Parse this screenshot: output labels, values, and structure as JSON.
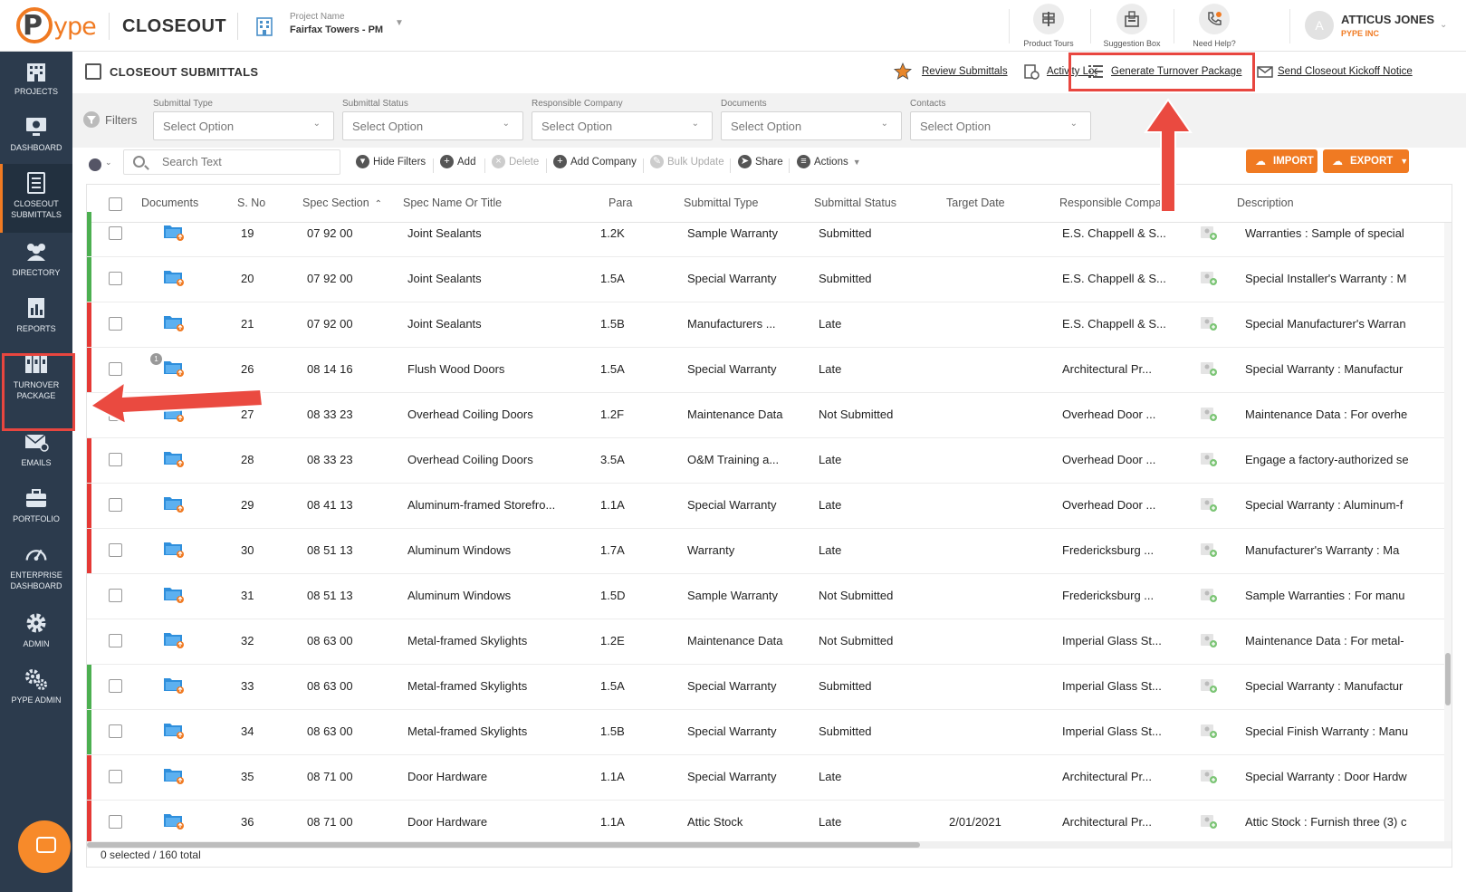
{
  "topbar": {
    "brand": "CLOSEOUT",
    "project_label": "Project Name",
    "project_name": "Fairfax Towers - PM",
    "actions": [
      {
        "label": "Product Tours"
      },
      {
        "label": "Suggestion Box"
      },
      {
        "label": "Need Help?"
      }
    ],
    "user": {
      "initial": "A",
      "name": "ATTICUS JONES",
      "org": "PYPE INC"
    }
  },
  "sidebar": {
    "items": [
      {
        "label": "PROJECTS",
        "icon": "building-icon"
      },
      {
        "label": "DASHBOARD",
        "icon": "monitor-icon"
      },
      {
        "label": "CLOSEOUT SUBMITTALS",
        "icon": "document-list-icon",
        "active": true
      },
      {
        "label": "DIRECTORY",
        "icon": "people-icon"
      },
      {
        "label": "REPORTS",
        "icon": "report-icon"
      },
      {
        "label": "TURNOVER PACKAGE",
        "icon": "binders-icon"
      },
      {
        "label": "EMAILS",
        "icon": "email-icon"
      },
      {
        "label": "PORTFOLIO",
        "icon": "briefcase-icon"
      },
      {
        "label": "ENTERPRISE DASHBOARD",
        "icon": "gauge-icon"
      },
      {
        "label": "ADMIN",
        "icon": "gear-icon"
      },
      {
        "label": "PYPE ADMIN",
        "icon": "gears-icon"
      }
    ]
  },
  "header": {
    "title": "CLOSEOUT SUBMITTALS",
    "links": {
      "review": "Review Submittals",
      "activity": "Activity Log",
      "generate": "Generate Turnover Package",
      "kickoff": "Send Closeout Kickoff Notice"
    }
  },
  "filters": {
    "label": "Filters",
    "fields": [
      {
        "caption": "Submittal Type",
        "value": "Select Option"
      },
      {
        "caption": "Submittal Status",
        "value": "Select Option"
      },
      {
        "caption": "Responsible Company",
        "value": "Select Option"
      },
      {
        "caption": "Documents",
        "value": "Select Option"
      },
      {
        "caption": "Contacts",
        "value": "Select Option"
      }
    ]
  },
  "toolbar": {
    "search_placeholder": "Search Text",
    "hide_filters": "Hide Filters",
    "add": "Add",
    "delete": "Delete",
    "add_company": "Add Company",
    "bulk_update": "Bulk Update",
    "share": "Share",
    "actions": "Actions",
    "import": "IMPORT",
    "export": "EXPORT"
  },
  "table": {
    "columns": {
      "documents": "Documents",
      "sno": "S. No",
      "spec_section": "Spec Section",
      "spec_name": "Spec Name Or Title",
      "para": "Para",
      "submittal_type": "Submittal Type",
      "submittal_status": "Submittal Status",
      "target_date": "Target Date",
      "responsible_company": "Responsible Compa",
      "description": "Description"
    },
    "rows": [
      {
        "status_color": "#4caf50",
        "sno": "19",
        "spec": "07 92 00",
        "name": "Joint Sealants",
        "para": "1.2K",
        "type": "Sample Warranty",
        "status": "Submitted",
        "target": "",
        "company": "E.S. Chappell & S...",
        "desc": "Warranties : Sample of special"
      },
      {
        "status_color": "#4caf50",
        "sno": "20",
        "spec": "07 92 00",
        "name": "Joint Sealants",
        "para": "1.5A",
        "type": "Special Warranty",
        "status": "Submitted",
        "target": "",
        "company": "E.S. Chappell & S...",
        "desc": "Special Installer's Warranty : M"
      },
      {
        "status_color": "#e53935",
        "sno": "21",
        "spec": "07 92 00",
        "name": "Joint Sealants",
        "para": "1.5B",
        "type": "Manufacturers ...",
        "status": "Late",
        "target": "",
        "company": "E.S. Chappell & S...",
        "desc": "Special Manufacturer's Warran"
      },
      {
        "status_color": "#e53935",
        "sno": "26",
        "spec": "08 14 16",
        "name": "Flush Wood Doors",
        "para": "1.5A",
        "type": "Special Warranty",
        "status": "Late",
        "target": "",
        "company": "Architectural Pr...",
        "desc": "Special Warranty : Manufactur",
        "badge": "1"
      },
      {
        "status_color": "",
        "sno": "27",
        "spec": "08 33 23",
        "name": "Overhead Coiling Doors",
        "para": "1.2F",
        "type": "Maintenance Data",
        "status": "Not Submitted",
        "target": "",
        "company": "Overhead Door ...",
        "desc": "Maintenance Data : For overhe"
      },
      {
        "status_color": "#e53935",
        "sno": "28",
        "spec": "08 33 23",
        "name": "Overhead Coiling Doors",
        "para": "3.5A",
        "type": "O&M Training a...",
        "status": "Late",
        "target": "",
        "company": "Overhead Door ...",
        "desc": "Engage a factory-authorized se"
      },
      {
        "status_color": "#e53935",
        "sno": "29",
        "spec": "08 41 13",
        "name": "Aluminum-framed Storefro...",
        "para": "1.1A",
        "type": "Special Warranty",
        "status": "Late",
        "target": "",
        "company": "Overhead Door ...",
        "desc": "Special Warranty : Aluminum-f"
      },
      {
        "status_color": "#e53935",
        "sno": "30",
        "spec": "08 51 13",
        "name": "Aluminum Windows",
        "para": "1.7A",
        "type": "Warranty",
        "status": "Late",
        "target": "",
        "company": "Fredericksburg ...",
        "desc": "Manufacturer's Warranty : Ma"
      },
      {
        "status_color": "",
        "sno": "31",
        "spec": "08 51 13",
        "name": "Aluminum Windows",
        "para": "1.5D",
        "type": "Sample Warranty",
        "status": "Not Submitted",
        "target": "",
        "company": "Fredericksburg ...",
        "desc": "Sample Warranties : For manu"
      },
      {
        "status_color": "",
        "sno": "32",
        "spec": "08 63 00",
        "name": "Metal-framed Skylights",
        "para": "1.2E",
        "type": "Maintenance Data",
        "status": "Not Submitted",
        "target": "",
        "company": "Imperial Glass St...",
        "desc": "Maintenance Data : For metal-"
      },
      {
        "status_color": "#4caf50",
        "sno": "33",
        "spec": "08 63 00",
        "name": "Metal-framed Skylights",
        "para": "1.5A",
        "type": "Special Warranty",
        "status": "Submitted",
        "target": "",
        "company": "Imperial Glass St...",
        "desc": "Special Warranty : Manufactur"
      },
      {
        "status_color": "#4caf50",
        "sno": "34",
        "spec": "08 63 00",
        "name": "Metal-framed Skylights",
        "para": "1.5B",
        "type": "Special Warranty",
        "status": "Submitted",
        "target": "",
        "company": "Imperial Glass St...",
        "desc": "Special Finish Warranty : Manu"
      },
      {
        "status_color": "#e53935",
        "sno": "35",
        "spec": "08 71 00",
        "name": "Door Hardware",
        "para": "1.1A",
        "type": "Special Warranty",
        "status": "Late",
        "target": "",
        "company": "Architectural Pr...",
        "desc": "Special Warranty : Door Hardw"
      },
      {
        "status_color": "#e53935",
        "sno": "36",
        "spec": "08 71 00",
        "name": "Door Hardware",
        "para": "1.1A",
        "type": "Attic Stock",
        "status": "Late",
        "target": "2/01/2021",
        "company": "Architectural Pr...",
        "desc": "Attic Stock : Furnish three (3) c"
      }
    ],
    "footer": "0 selected / 160 total"
  },
  "colors": {
    "accent": "#f07a22",
    "sidebar": "#2c3b4d",
    "annotation": "#e8463f"
  }
}
